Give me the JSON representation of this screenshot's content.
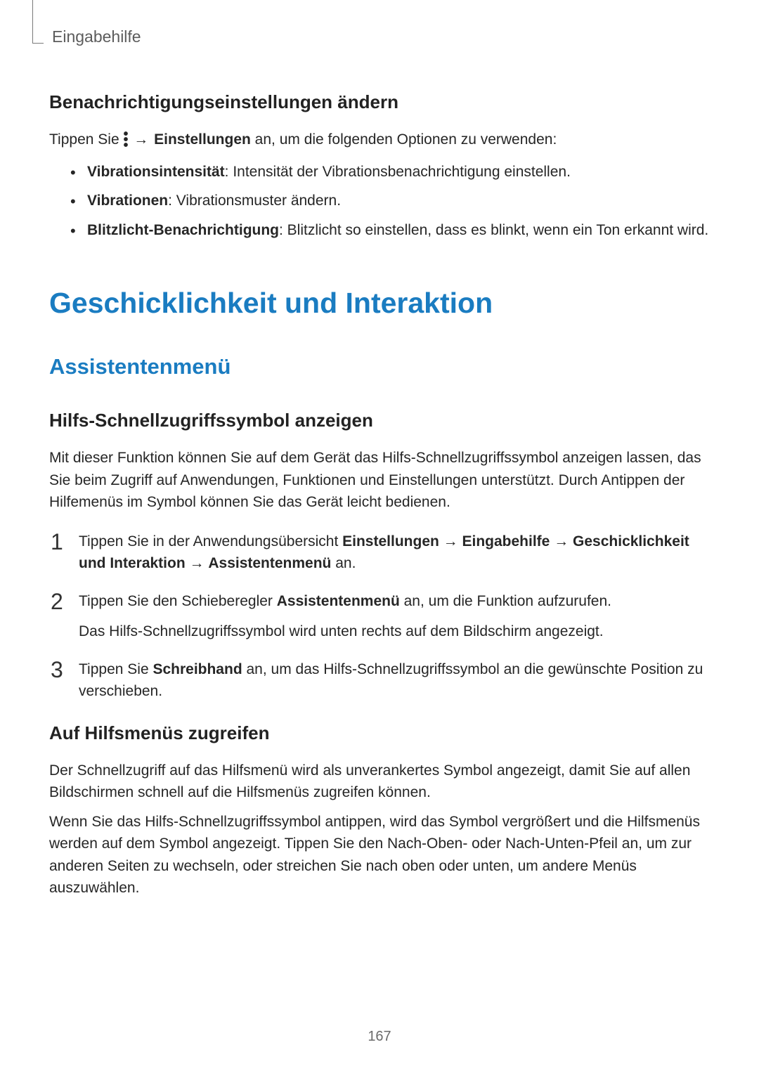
{
  "header": {
    "breadcrumb": "Eingabehilfe"
  },
  "section1": {
    "heading": "Benachrichtigungseinstellungen ändern",
    "intro_pre": "Tippen Sie ",
    "intro_mid": " → ",
    "intro_bold": "Einstellungen",
    "intro_post": " an, um die folgenden Optionen zu verwenden:",
    "bullets": [
      {
        "b": "Vibrationsintensität",
        "t": ": Intensität der Vibrationsbenachrichtigung einstellen."
      },
      {
        "b": "Vibrationen",
        "t": ": Vibrationsmuster ändern."
      },
      {
        "b": "Blitzlicht-Benachrichtigung",
        "t": ": Blitzlicht so einstellen, dass es blinkt, wenn ein Ton erkannt wird."
      }
    ]
  },
  "section2": {
    "heading": "Geschicklichkeit und Interaktion"
  },
  "section3": {
    "heading": "Assistentenmenü",
    "sub1": "Hilfs-Schnellzugriffssymbol anzeigen",
    "p1": "Mit dieser Funktion können Sie auf dem Gerät das Hilfs-Schnellzugriffssymbol anzeigen lassen, das Sie beim Zugriff auf Anwendungen, Funktionen und Einstellungen unterstützt. Durch Antippen der Hilfemenüs im Symbol können Sie das Gerät leicht bedienen.",
    "steps": [
      {
        "num": "1",
        "parts": [
          {
            "type": "text",
            "v": "Tippen Sie in der Anwendungsübersicht "
          },
          {
            "type": "bold",
            "v": "Einstellungen"
          },
          {
            "type": "text",
            "v": " → "
          },
          {
            "type": "bold",
            "v": "Eingabehilfe"
          },
          {
            "type": "text",
            "v": " → "
          },
          {
            "type": "bold",
            "v": "Geschicklichkeit und Interaktion"
          },
          {
            "type": "text",
            "v": " → "
          },
          {
            "type": "bold",
            "v": "Assistentenmenü"
          },
          {
            "type": "text",
            "v": " an."
          }
        ]
      },
      {
        "num": "2",
        "line1": [
          {
            "type": "text",
            "v": "Tippen Sie den Schieberegler "
          },
          {
            "type": "bold",
            "v": "Assistentenmenü"
          },
          {
            "type": "text",
            "v": " an, um die Funktion aufzurufen."
          }
        ],
        "line2": "Das Hilfs-Schnellzugriffssymbol wird unten rechts auf dem Bildschirm angezeigt."
      },
      {
        "num": "3",
        "parts": [
          {
            "type": "text",
            "v": "Tippen Sie "
          },
          {
            "type": "bold",
            "v": "Schreibhand"
          },
          {
            "type": "text",
            "v": " an, um das Hilfs-Schnellzugriffssymbol an die gewünschte Position zu verschieben."
          }
        ]
      }
    ],
    "sub2": "Auf Hilfsmenüs zugreifen",
    "p2": "Der Schnellzugriff auf das Hilfsmenü wird als unverankertes Symbol angezeigt, damit Sie auf allen Bildschirmen schnell auf die Hilfsmenüs zugreifen können.",
    "p3": "Wenn Sie das Hilfs-Schnellzugriffssymbol antippen, wird das Symbol vergrößert und die Hilfsmenüs werden auf dem Symbol angezeigt. Tippen Sie den Nach-Oben- oder Nach-Unten-Pfeil an, um zur anderen Seiten zu wechseln, oder streichen Sie nach oben oder unten, um andere Menüs auszuwählen."
  },
  "page_number": "167"
}
